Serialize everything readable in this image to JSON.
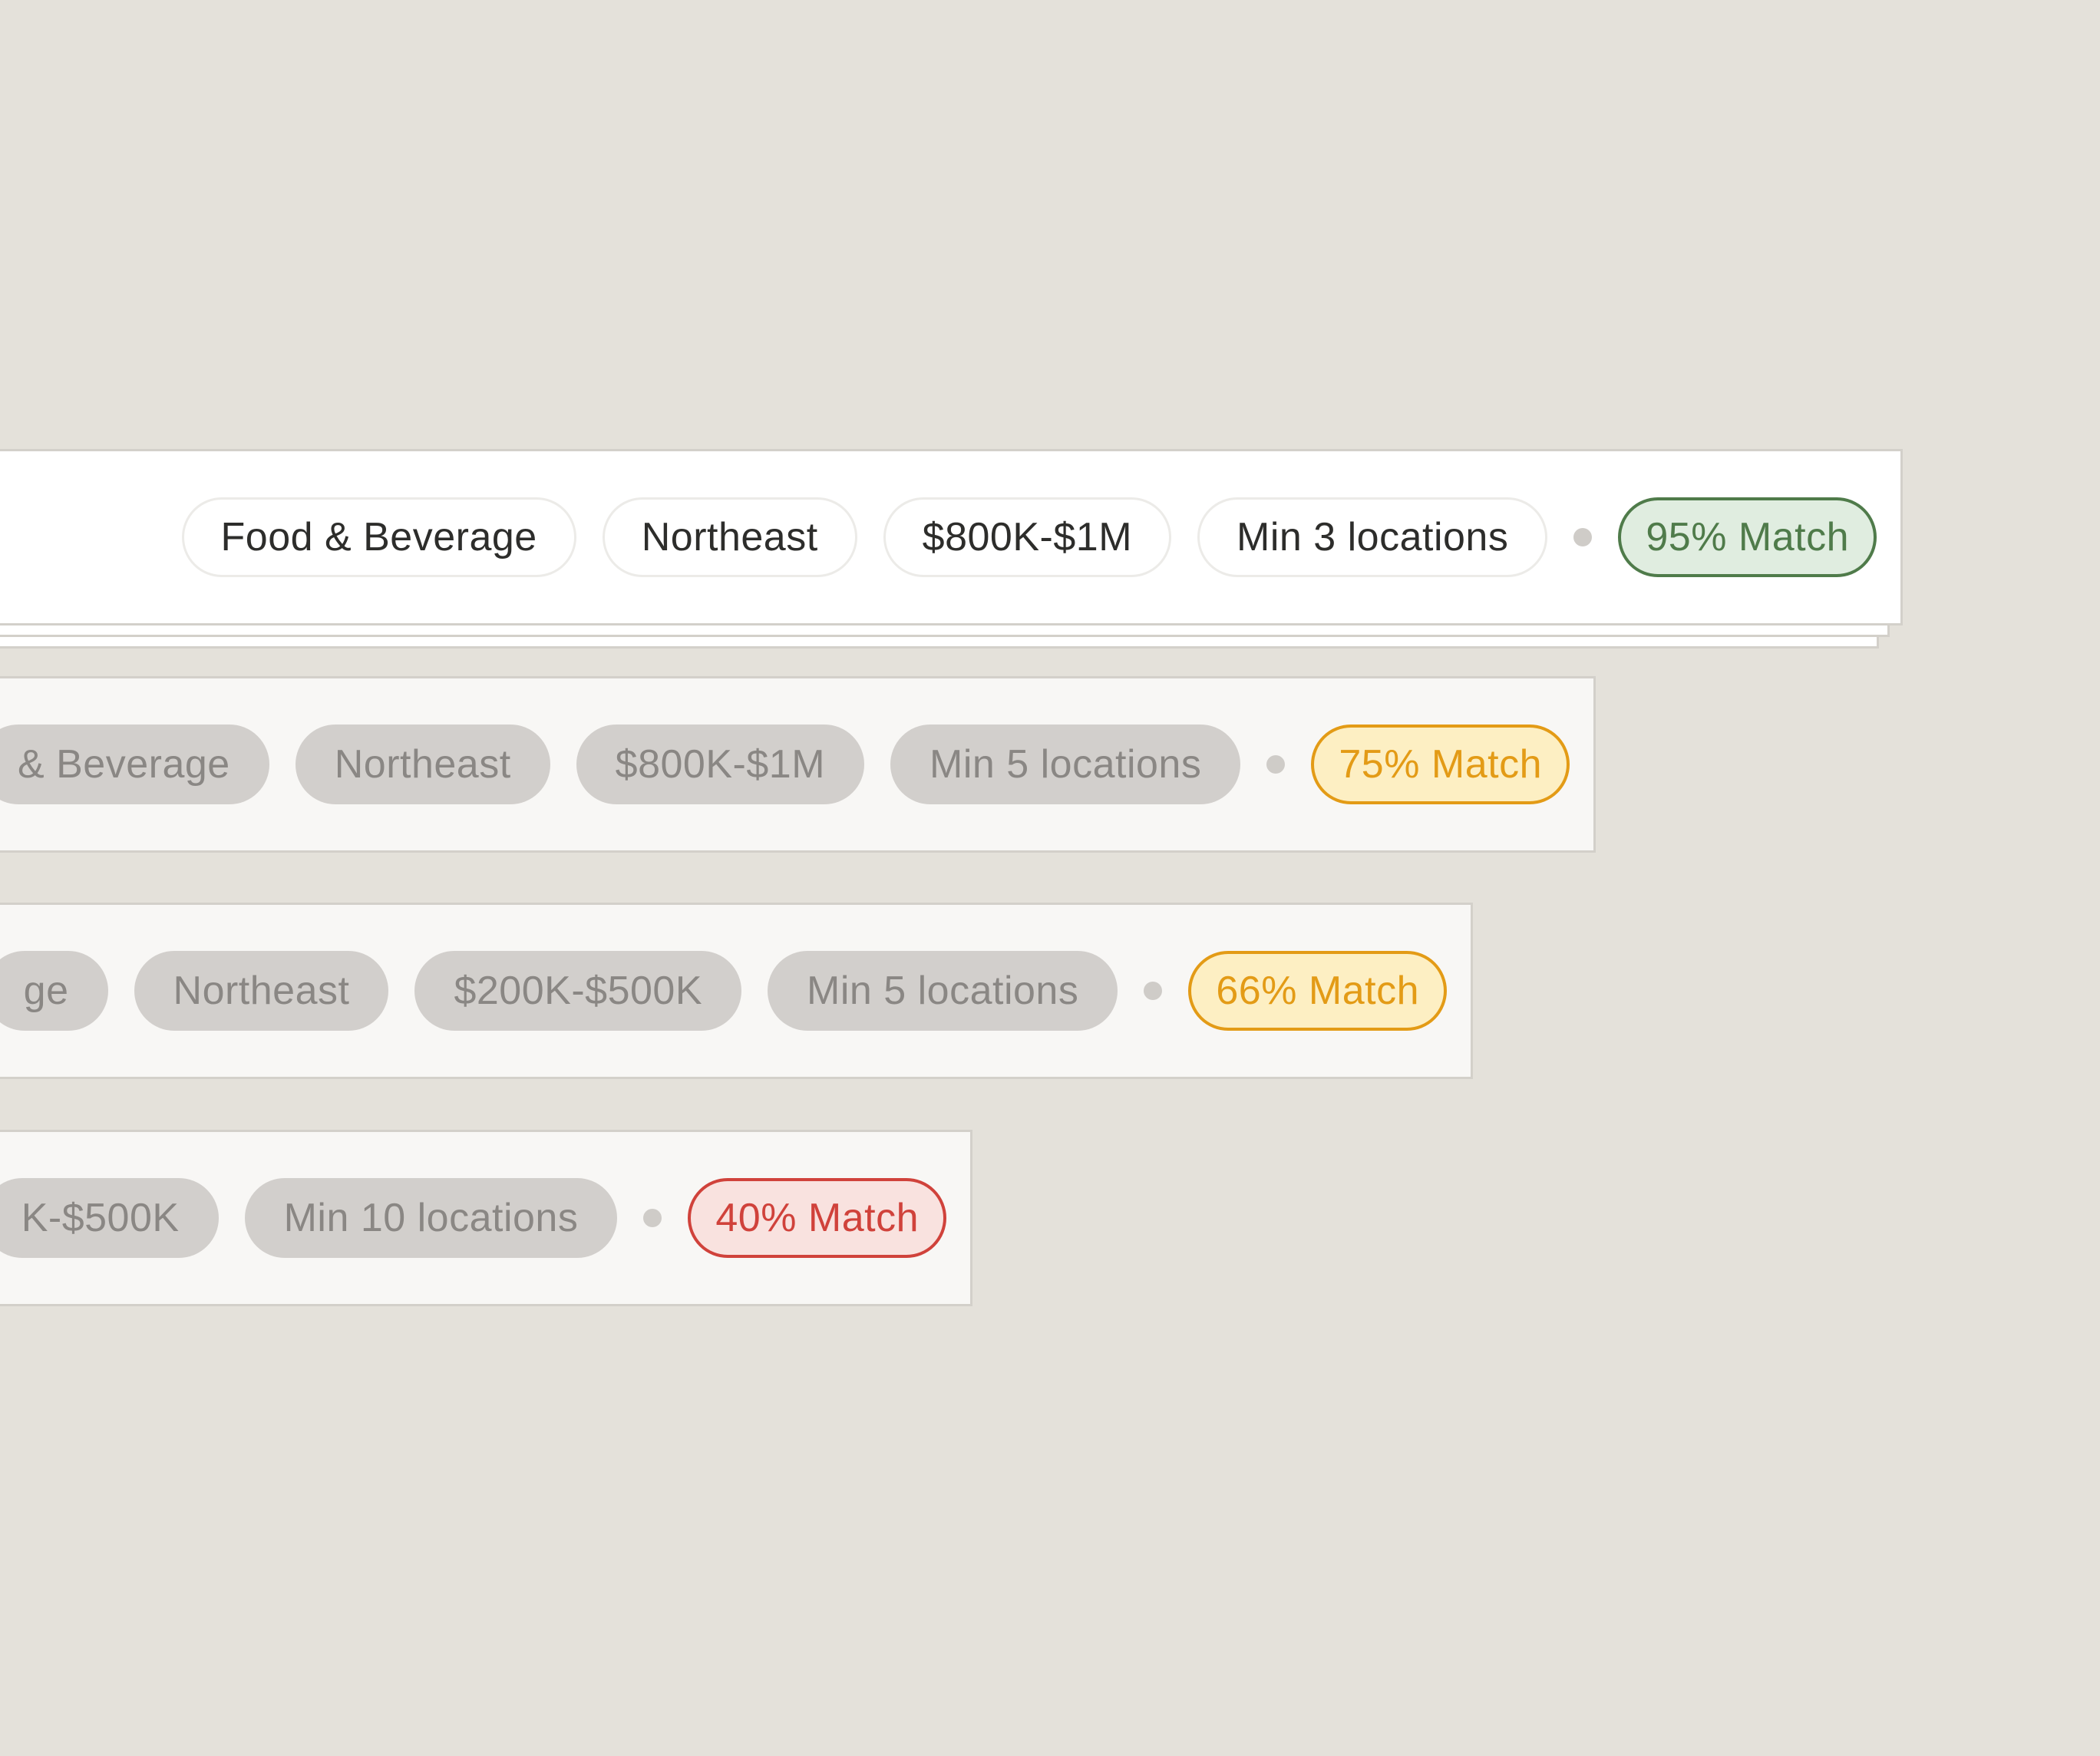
{
  "cards": [
    {
      "tags": [
        "Food & Beverage",
        "Northeast",
        "$800K-$1M",
        "Min 3 locations"
      ],
      "match": "95% Match",
      "match_color": "#4f7b4a"
    },
    {
      "tags": [
        "& Beverage",
        "Northeast",
        "$800K-$1M",
        "Min 5 locations"
      ],
      "match": "75% Match",
      "match_color": "#e39b16"
    },
    {
      "tags": [
        "ge",
        "Northeast",
        "$200K-$500K",
        "Min 5 locations"
      ],
      "match": "66% Match",
      "match_color": "#e39b16"
    },
    {
      "tags": [
        "K-$500K",
        "Min 10 locations"
      ],
      "match": "40% Match",
      "match_color": "#d0423b"
    }
  ]
}
